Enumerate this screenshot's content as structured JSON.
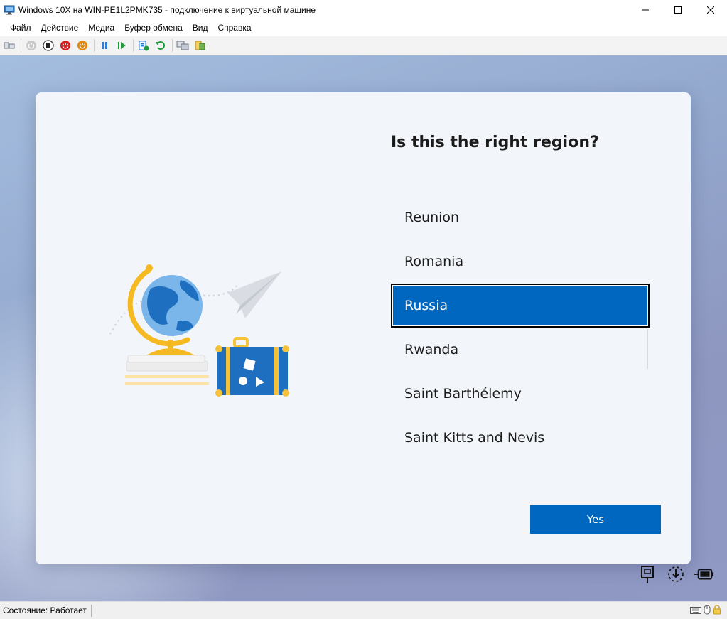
{
  "window": {
    "title": "Windows 10X на WIN-PE1L2PMK735 - подключение к виртуальной машине"
  },
  "menu": {
    "items": [
      "Файл",
      "Действие",
      "Медиа",
      "Буфер обмена",
      "Вид",
      "Справка"
    ]
  },
  "toolbar": {
    "buttons": [
      "ctrl-alt-del-icon",
      "start-icon",
      "turn-off-icon",
      "shutdown-icon",
      "save-icon",
      "pause-icon",
      "resume-icon",
      "checkpoint-icon",
      "revert-icon",
      "enhanced-session-icon",
      "share-icon"
    ]
  },
  "oobe": {
    "heading": "Is this the right region?",
    "regions": [
      "Reunion",
      "Romania",
      "Russia",
      "Rwanda",
      "Saint Barthélemy",
      "Saint Kitts and Nevis"
    ],
    "selected_region": "Russia",
    "yes_label": "Yes"
  },
  "statusbar": {
    "status": "Состояние: Работает"
  },
  "colors": {
    "accent": "#0067c0",
    "card_bg": "#f2f5f9"
  }
}
